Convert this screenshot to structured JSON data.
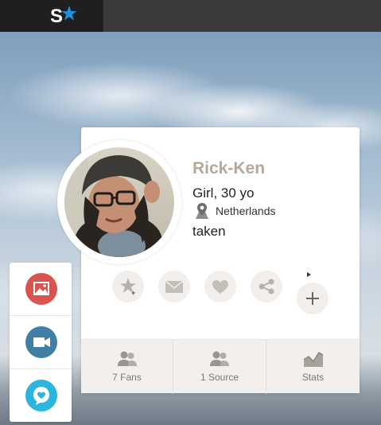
{
  "colors": {
    "topbar": "#3a3a3a",
    "logo_bg": "#1f1f1f",
    "accent_blue": "#1f8fe0",
    "name": "#b3a89b",
    "photos_red": "#d9534f",
    "video_blue": "#3f7fa6",
    "chat_cyan": "#2cb6de"
  },
  "header": {
    "logo_icon": "site-logo-s-star"
  },
  "profile": {
    "name": "Rick-Ken",
    "subtitle": "Girl, 30 yo",
    "location": "Netherlands",
    "status": "taken"
  },
  "actions": [
    {
      "icon": "star-add-icon"
    },
    {
      "icon": "envelope-icon"
    },
    {
      "icon": "heart-icon"
    },
    {
      "icon": "share-icon"
    },
    {
      "icon": "plus-icon"
    }
  ],
  "stats": [
    {
      "icon": "fans-icon",
      "label": "7 Fans"
    },
    {
      "icon": "source-icon",
      "label": "1 Source"
    },
    {
      "icon": "stats-icon",
      "label": "Stats"
    }
  ],
  "dock": [
    {
      "icon": "image-icon"
    },
    {
      "icon": "video-camera-icon"
    },
    {
      "icon": "chat-heart-icon"
    }
  ]
}
